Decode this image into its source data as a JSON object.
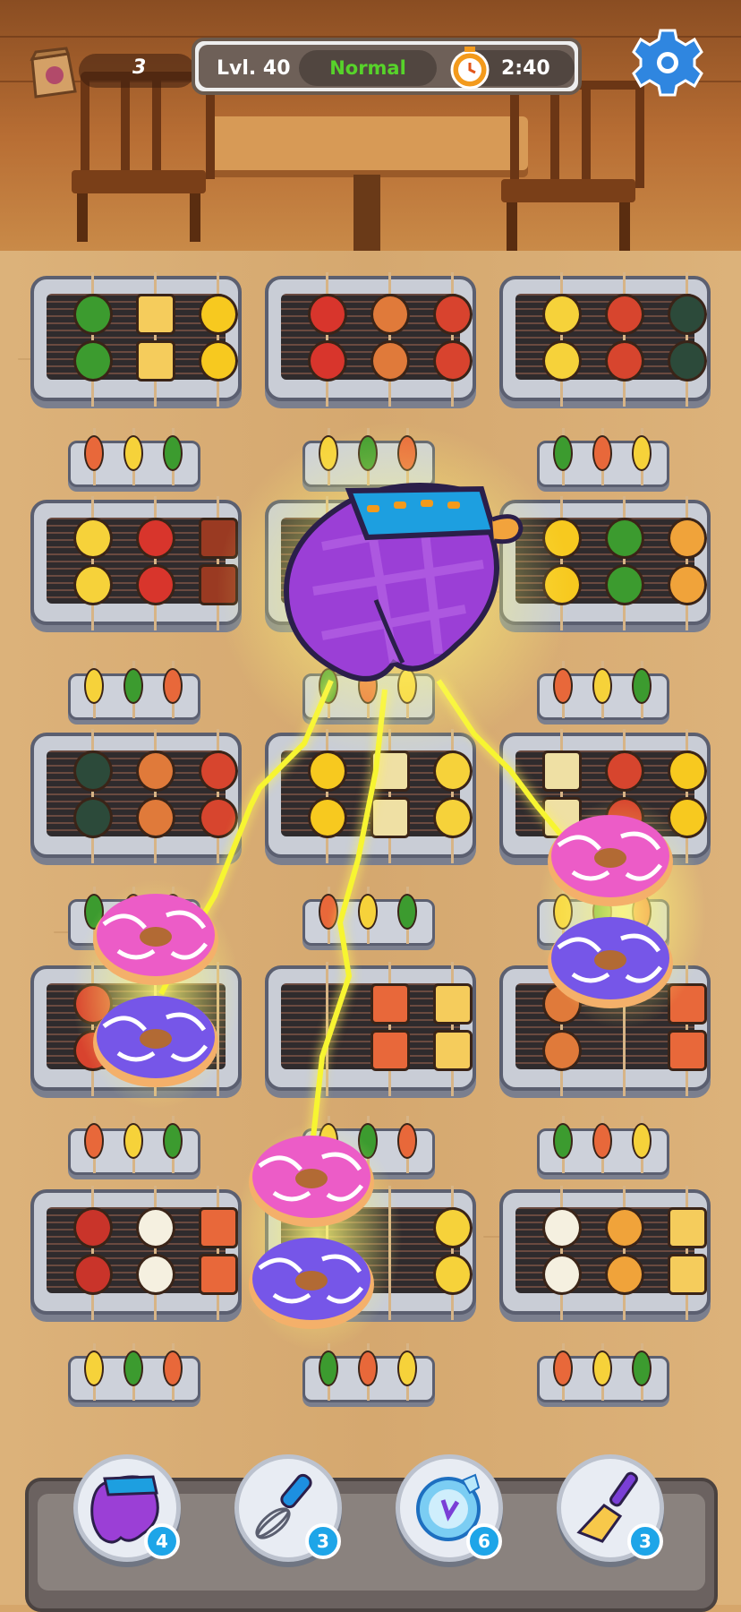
{
  "hud": {
    "bag_count": "3",
    "level_label": "Lvl. 40",
    "difficulty": "Normal",
    "timer": "2:40",
    "difficulty_color": "#57d32a"
  },
  "icons": {
    "bag": "food-bag-icon",
    "timer": "alarm-clock-icon",
    "settings": "gear-icon",
    "active_booster": "oven-mitt-icon"
  },
  "boosters": [
    {
      "name": "oven-mitt",
      "count": "4"
    },
    {
      "name": "whisk",
      "count": "3"
    },
    {
      "name": "frozen-clock",
      "count": "6"
    },
    {
      "name": "spatula",
      "count": "3"
    }
  ],
  "grills": [
    {
      "items": [
        "broccoli",
        "toast",
        "pineapple"
      ]
    },
    {
      "items": [
        "red-pepper",
        "chicken-leg",
        "sausage"
      ]
    },
    {
      "items": [
        "corn",
        "crab",
        "mussel"
      ]
    },
    {
      "items": [
        "corn",
        "red-pepper",
        "steak"
      ]
    },
    {
      "items": [
        "cabbage",
        "",
        "pineapple"
      ]
    },
    {
      "items": [
        "pineapple",
        "broccoli",
        "potato"
      ]
    },
    {
      "items": [
        "mussel",
        "chicken-leg",
        "crab"
      ]
    },
    {
      "items": [
        "pineapple",
        "tofu",
        "corn"
      ]
    },
    {
      "items": [
        "tofu",
        "crab",
        "pineapple"
      ]
    },
    {
      "items": [
        "sausage",
        "",
        ""
      ]
    },
    {
      "items": [
        "",
        "salmon",
        "toast"
      ]
    },
    {
      "items": [
        "chicken-leg",
        "",
        "salmon"
      ]
    },
    {
      "items": [
        "lobster",
        "cauliflower",
        "salmon"
      ]
    },
    {
      "items": [
        "",
        "",
        "corn"
      ]
    },
    {
      "items": [
        "cauliflower",
        "potato",
        "toast"
      ]
    }
  ],
  "donut_stacks": [
    {
      "top": "pink-donut",
      "bottom": "purple-donut"
    },
    {
      "top": "pink-donut",
      "bottom": "purple-donut"
    },
    {
      "top": "pink-donut",
      "bottom": "purple-donut"
    }
  ],
  "colors": {
    "board": "#d5a86f",
    "grill_frame": "#c9cdd6",
    "badge": "#1ea5e8",
    "mitt": "#9b3fd6",
    "lightning": "#f7f531"
  }
}
